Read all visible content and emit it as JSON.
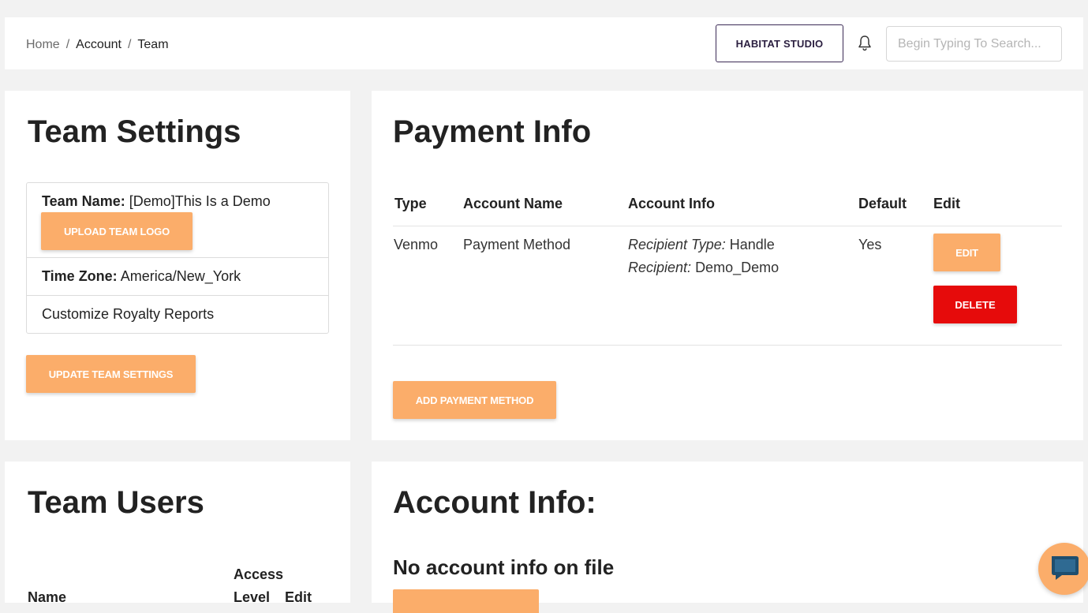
{
  "breadcrumb": {
    "home": "Home",
    "sep1": "/",
    "account": "Account",
    "sep2": "/",
    "team": "Team"
  },
  "header": {
    "studio_label": "HABITAT STUDIO",
    "search_placeholder": "Begin Typing To Search..."
  },
  "team_settings": {
    "title": "Team Settings",
    "team_name_label": "Team Name:",
    "team_name_value": "[Demo]This Is a Demo",
    "upload_logo_label": "UPLOAD TEAM LOGO",
    "time_zone_label": "Time Zone:",
    "time_zone_value": "America/New_York",
    "customize_label": "Customize Royalty Reports",
    "update_label": "UPDATE TEAM SETTINGS"
  },
  "payment_info": {
    "title": "Payment Info",
    "columns": [
      "Type",
      "Account Name",
      "Account Info",
      "Default",
      "Edit"
    ],
    "rows": [
      {
        "type": "Venmo",
        "account_name": "Payment Method",
        "recipient_type_label": "Recipient Type:",
        "recipient_type_value": "Handle",
        "recipient_label": "Recipient:",
        "recipient_value": "Demo_Demo",
        "default": "Yes",
        "edit_label": "EDIT",
        "delete_label": "DELETE"
      }
    ],
    "add_label": "ADD PAYMENT METHOD"
  },
  "team_users": {
    "title": "Team Users",
    "col_name": "Name",
    "col_access_1": "Access",
    "col_access_2": "Level",
    "col_edit": "Edit"
  },
  "account_info": {
    "title": "Account Info:",
    "empty_message": "No account info on file"
  },
  "colors": {
    "accent": "#fbad6a",
    "danger": "#e60b0b",
    "studio_border": "#3b2a55"
  },
  "icons": {
    "notifications": "bell-icon",
    "chat": "chat-bubble-icon"
  }
}
